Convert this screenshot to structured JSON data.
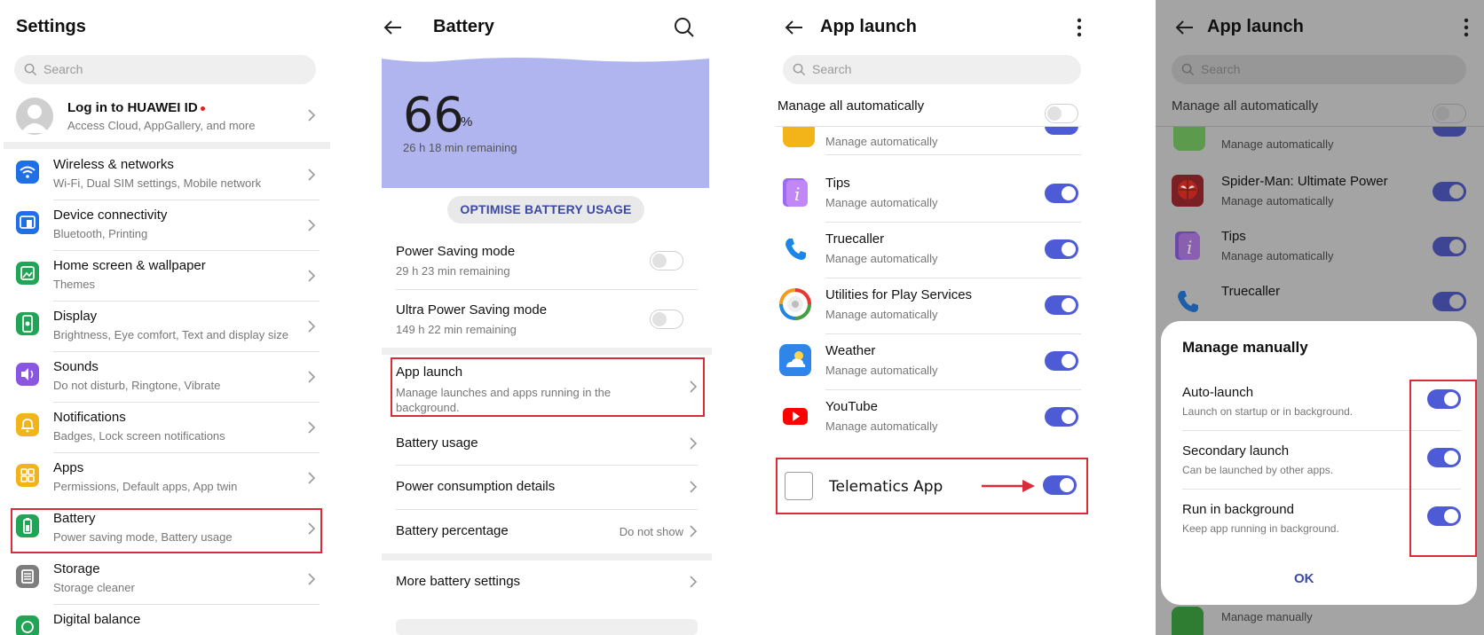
{
  "panel1": {
    "title": "Settings",
    "search_placeholder": "Search",
    "account": {
      "title": "Log in to HUAWEI ID",
      "subtitle": "Access Cloud, AppGallery, and more"
    },
    "items": [
      {
        "title": "Wireless & networks",
        "subtitle": "Wi-Fi, Dual SIM settings, Mobile network",
        "icon": "wifi-icon",
        "color": "#1f6fe6"
      },
      {
        "title": "Device connectivity",
        "subtitle": "Bluetooth, Printing",
        "icon": "device-connectivity-icon",
        "color": "#1f6fe6"
      },
      {
        "title": "Home screen & wallpaper",
        "subtitle": "Themes",
        "icon": "wallpaper-icon",
        "color": "#22a456"
      },
      {
        "title": "Display",
        "subtitle": "Brightness, Eye comfort, Text and display size",
        "icon": "display-icon",
        "color": "#22a456"
      },
      {
        "title": "Sounds",
        "subtitle": "Do not disturb, Ringtone, Vibrate",
        "icon": "sound-icon",
        "color": "#8a55e0"
      },
      {
        "title": "Notifications",
        "subtitle": "Badges, Lock screen notifications",
        "icon": "bell-icon",
        "color": "#f2b418"
      },
      {
        "title": "Apps",
        "subtitle": "Permissions, Default apps, App twin",
        "icon": "apps-icon",
        "color": "#f2b418"
      },
      {
        "title": "Battery",
        "subtitle": "Power saving mode, Battery usage",
        "icon": "battery-icon",
        "color": "#22a456"
      },
      {
        "title": "Storage",
        "subtitle": "Storage cleaner",
        "icon": "storage-icon",
        "color": "#7d7d7d"
      },
      {
        "title": "Digital balance",
        "subtitle": "",
        "icon": "digital-balance-icon",
        "color": "#22a456"
      }
    ]
  },
  "panel2": {
    "title": "Battery",
    "battery_percent": "66",
    "percent_unit": "%",
    "remaining": "26 h 18 min remaining",
    "optimise_button": "OPTIMISE BATTERY USAGE",
    "power_saving": {
      "title": "Power Saving mode",
      "subtitle": "29 h 23 min remaining"
    },
    "ultra_power_saving": {
      "title": "Ultra Power Saving mode",
      "subtitle": "149 h 22 min remaining"
    },
    "app_launch": {
      "title": "App launch",
      "subtitle": "Manage launches and apps running in the background."
    },
    "battery_usage": "Battery usage",
    "power_consumption": "Power consumption details",
    "battery_percentage": {
      "title": "Battery percentage",
      "value": "Do not show"
    },
    "more_settings": "More battery settings"
  },
  "panel3": {
    "title": "App launch",
    "search_placeholder": "Search",
    "manage_all": "Manage all automatically",
    "partial_subtitle": "Manage automatically",
    "apps": [
      {
        "name": "Tips",
        "subtitle": "Manage automatically",
        "icon": "tips-icon"
      },
      {
        "name": "Truecaller",
        "subtitle": "Manage automatically",
        "icon": "phone-icon"
      },
      {
        "name": "Utilities for Play Services",
        "subtitle": "Manage automatically",
        "icon": "utilities-icon"
      },
      {
        "name": "Weather",
        "subtitle": "Manage automatically",
        "icon": "weather-icon"
      },
      {
        "name": "YouTube",
        "subtitle": "Manage automatically",
        "icon": "youtube-icon"
      }
    ],
    "telematics_app": "Telematics App"
  },
  "panel4": {
    "title": "App launch",
    "search_placeholder": "Search",
    "manage_all": "Manage all automatically",
    "partial_subtitle": "Manage automatically",
    "apps": [
      {
        "name": "Spider-Man: Ultimate Power",
        "subtitle": "Manage automatically",
        "icon": "spiderman-icon"
      },
      {
        "name": "Tips",
        "subtitle": "Manage automatically",
        "icon": "tips-icon"
      },
      {
        "name": "Truecaller",
        "subtitle": "Manage automatically",
        "icon": "phone-icon"
      }
    ],
    "bottom_subtitle": "Manage manually",
    "dialog": {
      "title": "Manage manually",
      "options": [
        {
          "title": "Auto-launch",
          "subtitle": "Launch on startup or in background."
        },
        {
          "title": "Secondary launch",
          "subtitle": "Can be launched by other apps."
        },
        {
          "title": "Run in background",
          "subtitle": "Keep app running in background."
        }
      ],
      "ok": "OK"
    }
  },
  "colors": {
    "accent": "#4e5bd6",
    "highlight": "#d92b3a",
    "battery_card": "#b0b5ef"
  }
}
